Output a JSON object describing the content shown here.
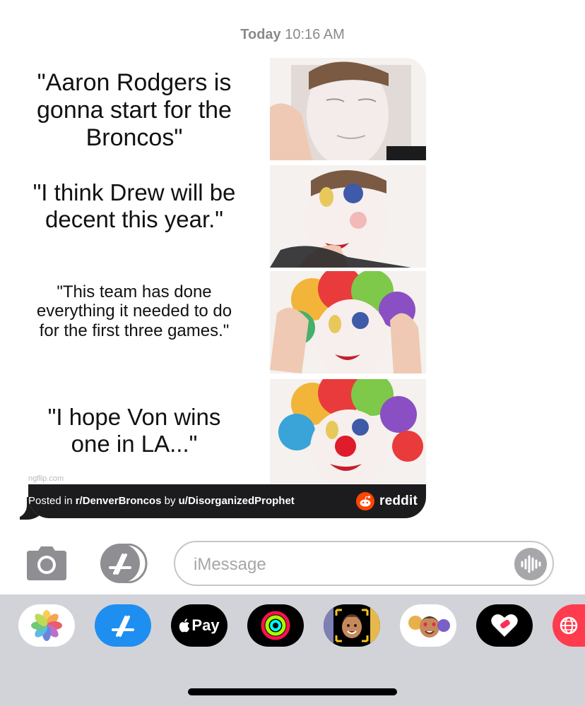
{
  "timestamp": {
    "day": "Today",
    "time": "10:16 AM"
  },
  "message": {
    "meme": {
      "panels": [
        {
          "text": "\"Aaron Rodgers is gonna start for the Broncos\""
        },
        {
          "text": "\"I think Drew will be decent this year.\""
        },
        {
          "text": "\"This team has done everything it needed to do for the first three games.\""
        },
        {
          "text": "\"I hope Von wins one in LA...\""
        }
      ],
      "watermark": "ngflip.com"
    },
    "caption": {
      "prefix": "Posted in ",
      "subreddit": "r/DenverBroncos",
      "middle": " by ",
      "user": "u/DisorganizedProphet",
      "brand": "reddit"
    }
  },
  "input": {
    "placeholder": "iMessage"
  },
  "apps": [
    {
      "name": "photos-app-icon"
    },
    {
      "name": "app-store-app-icon"
    },
    {
      "name": "apple-pay-app-icon",
      "label": "Pay"
    },
    {
      "name": "activity-app-icon"
    },
    {
      "name": "memoji-app-icon"
    },
    {
      "name": "memoji-stickers-app-icon"
    },
    {
      "name": "heart-app-icon"
    },
    {
      "name": "web-search-app-icon"
    }
  ],
  "colors": {
    "reddit_orange": "#ff4500",
    "drawer_bg": "#d2d3d8",
    "caption_bg": "#1c1c1e"
  }
}
